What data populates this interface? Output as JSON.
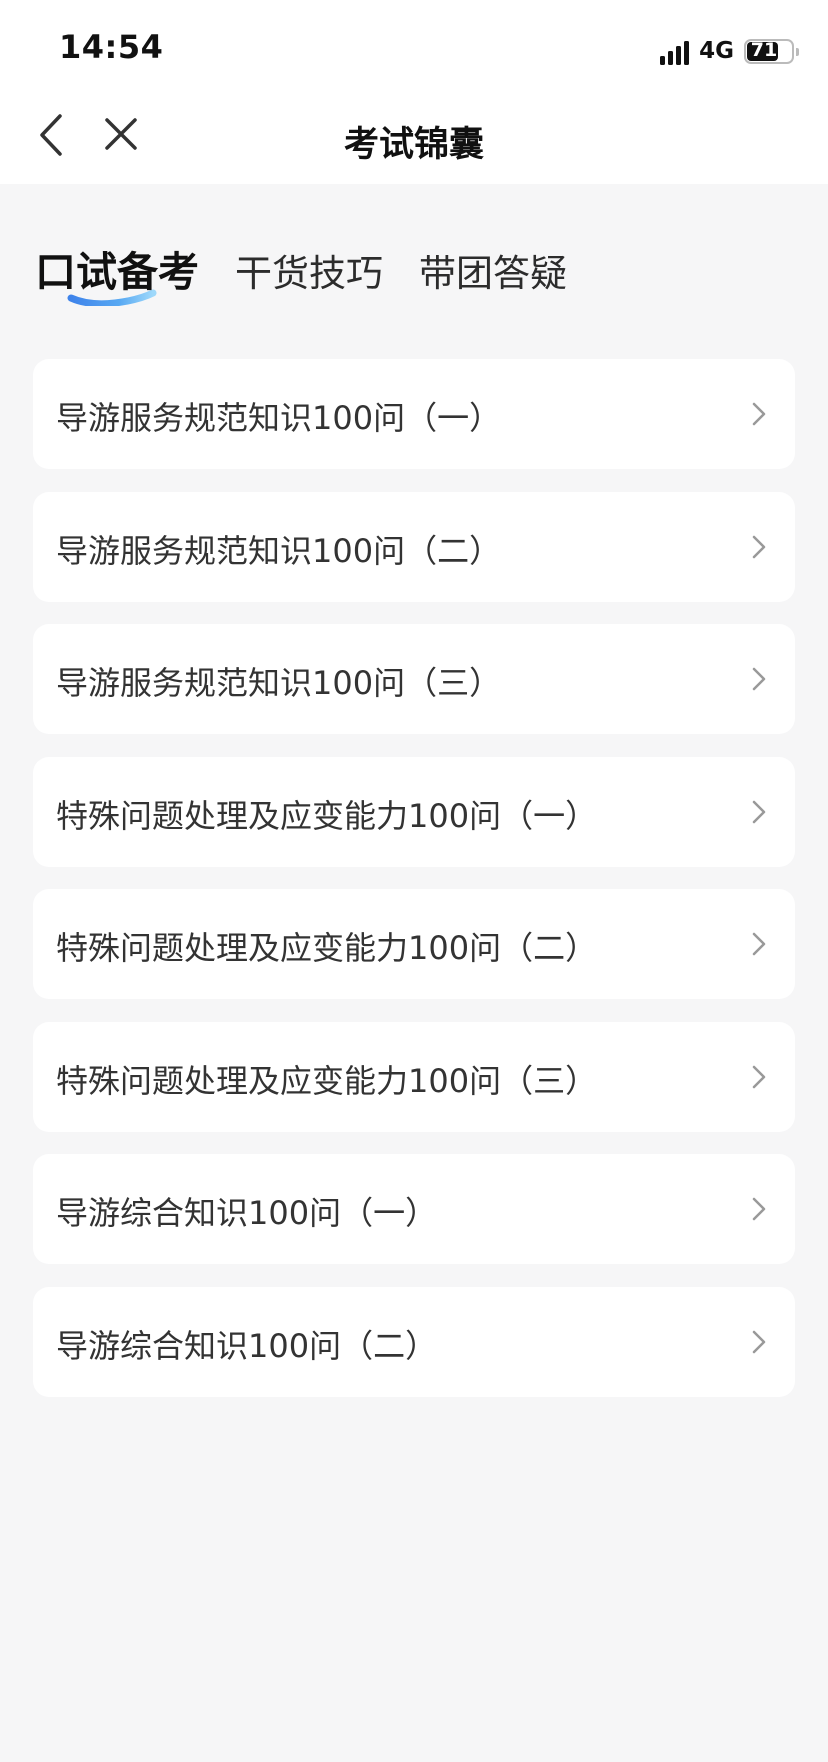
{
  "status_bar": {
    "time": "14:54",
    "network": "4G",
    "battery": "71",
    "battery_level": 0.71
  },
  "nav": {
    "title": "考试锦囊",
    "back_icon": "chevron-left-icon",
    "close_icon": "close-icon"
  },
  "tabs": [
    {
      "label": "口试备考",
      "active": true
    },
    {
      "label": "干货技巧",
      "active": false
    },
    {
      "label": "带团答疑",
      "active": false
    }
  ],
  "accent_colors": {
    "tab_underline_start": "#4fc3f7",
    "tab_underline_end": "#1e6fe8"
  },
  "list": {
    "items": [
      {
        "label": "导游服务规范知识100问（一）"
      },
      {
        "label": "导游服务规范知识100问（二）"
      },
      {
        "label": "导游服务规范知识100问（三）"
      },
      {
        "label": "特殊问题处理及应变能力100问（一）"
      },
      {
        "label": "特殊问题处理及应变能力100问（二）"
      },
      {
        "label": "特殊问题处理及应变能力100问（三）"
      },
      {
        "label": "导游综合知识100问（一）"
      },
      {
        "label": "导游综合知识100问（二）"
      }
    ],
    "chevron_icon": "chevron-right-icon"
  }
}
